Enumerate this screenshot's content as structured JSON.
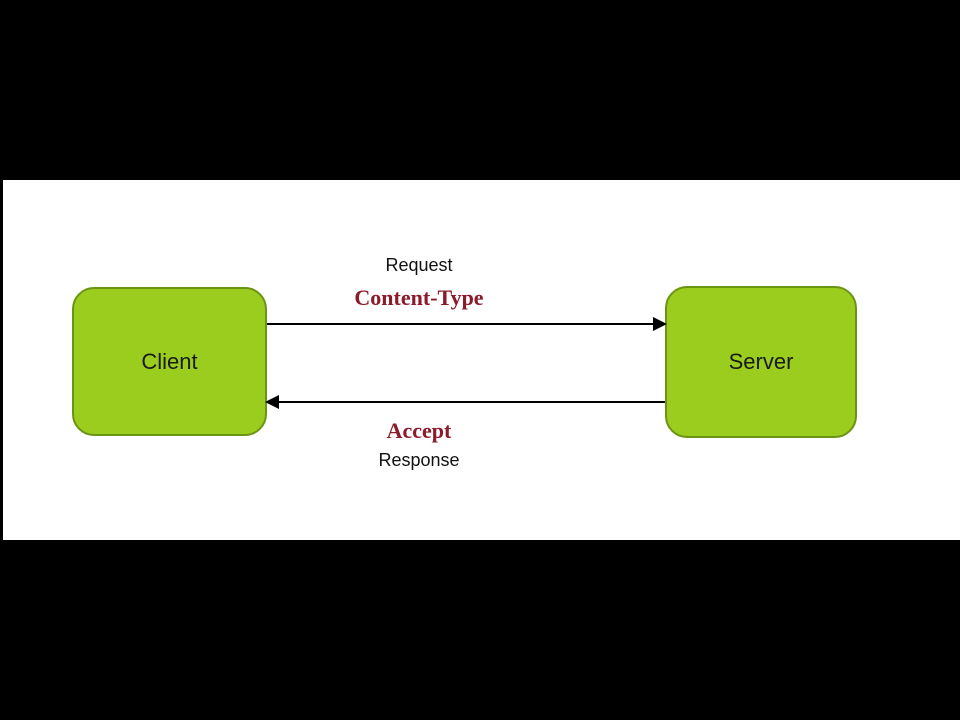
{
  "nodes": {
    "client": {
      "label": "Client"
    },
    "server": {
      "label": "Server"
    }
  },
  "labels": {
    "request": "Request",
    "content_type": "Content-Type",
    "accept": "Accept",
    "response": "Response"
  },
  "colors": {
    "node_fill": "#9acd1e",
    "node_stroke": "#6b9412",
    "header_text": "#8b1a2b",
    "plain_text": "#111111"
  }
}
